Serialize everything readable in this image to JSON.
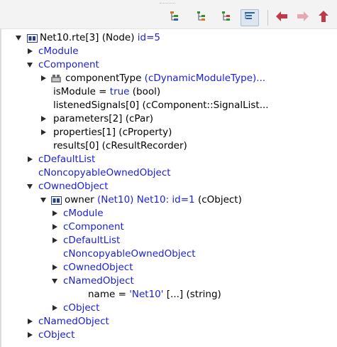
{
  "toolbar": {
    "buttons": [
      {
        "name": "tree-mode-children-icon",
        "active": false
      },
      {
        "name": "tree-mode-grouped-icon",
        "active": false
      },
      {
        "name": "tree-mode-inheritance-icon",
        "active": false
      },
      {
        "name": "tree-mode-flat-icon",
        "active": true
      },
      {
        "name": "back-arrow-icon",
        "active": false
      },
      {
        "name": "forward-arrow-icon",
        "active": false
      },
      {
        "name": "up-arrow-icon",
        "active": false
      }
    ],
    "colors": {
      "arrow": "#c0394b",
      "tree_green": "#2f8f2f",
      "tree_blue": "#2962a8",
      "tree_orange": "#d9731c"
    }
  },
  "tree": {
    "r0": {
      "main": "Net10.rte[3] (Node)",
      "accent": " id=5"
    },
    "r1": "cModule",
    "r2": "cComponent",
    "r3": {
      "main": "componentType",
      "accent": " (cDynamicModuleType)..."
    },
    "r4": {
      "main": "isModule = ",
      "accent": "true",
      "suffix": " (bool)"
    },
    "r5": "listenedSignals[0] (cComponent::SignalList...",
    "r6": "parameters[2] (cPar)",
    "r7": "properties[1] (cProperty)",
    "r8": "results[0] (cResultRecorder)",
    "r9": "cDefaultList",
    "r10": "cNoncopyableOwnedObject",
    "r11": "cOwnedObject",
    "r12": {
      "main": "owner",
      "accent": " (Net10) Net10: id=1",
      "suffix": " (cObject)"
    },
    "r13": "cModule",
    "r14": "cComponent",
    "r15": "cDefaultList",
    "r16": "cNoncopyableOwnedObject",
    "r17": "cOwnedObject",
    "r18": "cNamedObject",
    "r19": {
      "main": "name = ",
      "accent": "'Net10'",
      "suffix": " [...]  (string)"
    },
    "r20": "cObject",
    "r21": "cNamedObject",
    "r22": "cObject"
  }
}
